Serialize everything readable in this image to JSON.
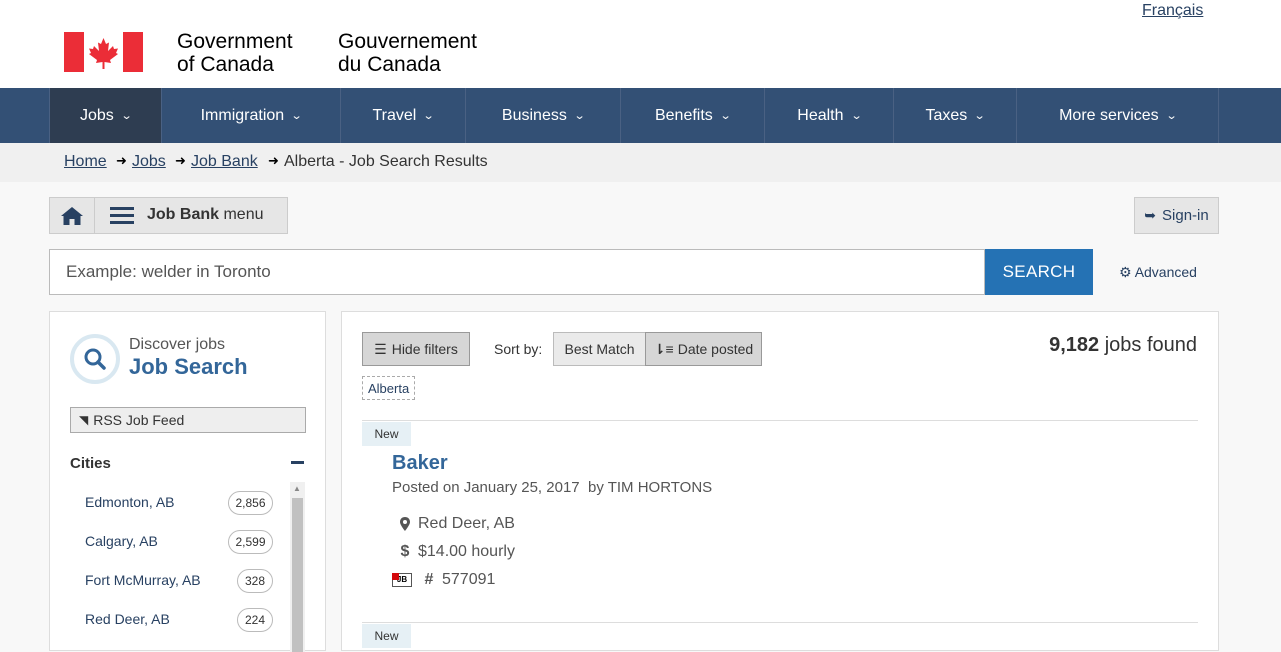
{
  "header": {
    "language_link": "Français",
    "gov_en_line1": "Government",
    "gov_en_line2": "of Canada",
    "gov_fr_line1": "Gouvernement",
    "gov_fr_line2": "du Canada",
    "flag_color": "#eb2d37"
  },
  "nav": {
    "items": [
      {
        "label": "Jobs"
      },
      {
        "label": "Immigration"
      },
      {
        "label": "Travel"
      },
      {
        "label": "Business"
      },
      {
        "label": "Benefits"
      },
      {
        "label": "Health"
      },
      {
        "label": "Taxes"
      },
      {
        "label": "More services"
      }
    ]
  },
  "breadcrumb": {
    "items": [
      "Home",
      "Jobs",
      "Job Bank"
    ],
    "current": "Alberta - Job Search Results"
  },
  "jobbank_menu": {
    "label_bold": "Job Bank",
    "label_rest": "menu"
  },
  "signin": {
    "label": "Sign-in"
  },
  "search": {
    "placeholder": "Example: welder in Toronto",
    "button": "SEARCH",
    "advanced": "Advanced"
  },
  "sidebar": {
    "discover": "Discover jobs",
    "title": "Job Search",
    "rss": "RSS Job Feed",
    "cities_heading": "Cities",
    "cities": [
      {
        "name": "Edmonton, AB",
        "count": "2,856"
      },
      {
        "name": "Calgary, AB",
        "count": "2,599"
      },
      {
        "name": "Fort McMurray, AB",
        "count": "328"
      },
      {
        "name": "Red Deer, AB",
        "count": "224"
      }
    ]
  },
  "results": {
    "hide_filters": "Hide filters",
    "sort_by": "Sort by:",
    "sort_best": "Best Match",
    "sort_date": "Date posted",
    "count": "9,182",
    "count_suffix": "jobs found",
    "filter_tag": "Alberta",
    "jobs": [
      {
        "badge": "New",
        "title": "Baker",
        "posted": "Posted on January 25, 2017",
        "by": "by TIM HORTONS",
        "location": "Red Deer, AB",
        "salary": "$14.00 hourly",
        "job_number": "577091",
        "jb_icon": "JB"
      },
      {
        "badge": "New"
      }
    ]
  },
  "colors": {
    "nav_bg": "#335075",
    "nav_active": "#2e3d51",
    "search_button": "#2572b4",
    "link": "#284162",
    "title": "#336699"
  }
}
